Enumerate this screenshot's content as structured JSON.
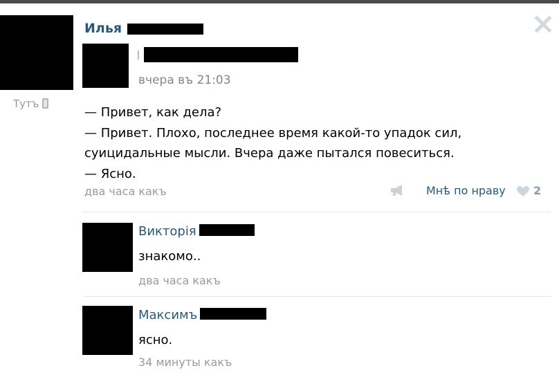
{
  "post": {
    "author_first_name": "Илья",
    "online_label": "Тутъ",
    "repost": {
      "time": "вчера въ 21:03"
    },
    "text_lines": [
      "— Привет, как дела?",
      "— Привет. Плохо, последнее время какой-то упадок сил,",
      "суицидальные мысли. Вчера даже пытался повеситься.",
      "— Ясно."
    ],
    "time": "два часа какъ",
    "like_label": "Мнѣ по нраву",
    "like_count": "2"
  },
  "comments": [
    {
      "author_first_name": "Викторія",
      "text": "знакомо..",
      "time": "два часа какъ"
    },
    {
      "author_first_name": "Максимъ",
      "text": "ясно.",
      "time": "34 минуты какъ"
    }
  ],
  "icons": {
    "close": "close-icon",
    "phone": "mobile-phone-icon",
    "share": "megaphone-icon",
    "like": "heart-icon"
  },
  "colors": {
    "name_link": "#2b587a",
    "meta_gray": "#9a9a9a",
    "divider": "#e3e8ee"
  }
}
